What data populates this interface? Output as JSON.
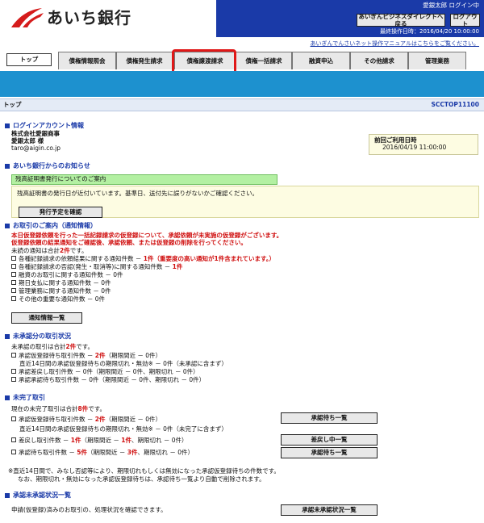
{
  "header": {
    "logo_text": "あいち銀行",
    "user_status": "愛銀太郎 ログイン中",
    "btn_direct": "あいぎんビジネスダイレクトへ戻る",
    "btn_logout": "ログアウト",
    "last_operation": "最終操作日時：2016/04/20 10:00:00",
    "manual_link": "あいぎんでんさいネット操作マニュアルはこちらをご覧ください。"
  },
  "tabs": [
    "トップ",
    "債権情報照会",
    "債権発生請求",
    "債権譲渡請求",
    "債権一括請求",
    "融資申込",
    "その他請求",
    "管理業務"
  ],
  "title_bar": {
    "title": "トップ",
    "code": "SCCTOP11100"
  },
  "login_account": {
    "heading": "ログインアカウント情報",
    "company": "株式会社愛銀商事",
    "name": "愛銀太郎 様",
    "email": "taro@aigin.co.jp",
    "last_login_label": "前回ご利用日時",
    "last_login_value": "2016/04/19 11:00:00"
  },
  "notice": {
    "heading": "あいち銀行からのお知らせ",
    "bar_text": "残高証明書発行についてのご案内",
    "body": "残高証明書の発行日が近付いています。基準日、送付先に誤りがないかご確認ください。",
    "button": "発行予定を確認"
  },
  "transactions_notice": {
    "heading": "お取引のご案内（通知情報）",
    "alert1": "本日仮登録依頼を行った一括記録請求の仮登録について、承認依頼が未実施の仮登録がございます。",
    "alert2": "仮登録依頼の結果通知をご確認後、承認依頼、または仮登録の削除を行ってください。",
    "unread_prefix": "未読の通知は合計",
    "unread_count": "2件",
    "unread_suffix": "です。",
    "items": [
      {
        "label": "各種記録請求の依頼結果に関する通知件数 －",
        "count": "1件（重要度の高い通知が1件含まれています。）",
        "red": true
      },
      {
        "label": "各種記録請求の否認(発生・取消等)に関する通知件数 －",
        "count": "1件",
        "red": true
      },
      {
        "label": "融資のお取引に関する通知件数 －",
        "count": "0件",
        "red": false
      },
      {
        "label": "期日支払に関する通知件数 －",
        "count": "0件",
        "red": false
      },
      {
        "label": "管理業務に関する通知件数 －",
        "count": "0件",
        "red": false
      },
      {
        "label": "その他の重要な通知件数 －",
        "count": "0件",
        "red": false
      }
    ],
    "button": "通知情報一覧"
  },
  "unapproved": {
    "heading": "未承認分の取引状況",
    "total_prefix": "未承認の取引は合計",
    "total_count": "2件",
    "total_suffix": "です。",
    "line1_label": "承認仮登録待ち取引件数 －",
    "line1_count": "2件",
    "line1_rest": "（期限間近 － 0件）",
    "line1_sub": "直近14日間の承認仮登録待ちの期限切れ・無効※ － 0件（未承認に含まず）",
    "line2": "承認差戻し取引件数 － 0件（期限間近 － 0件、期限切れ － 0件）",
    "line3": "承認承認待ち取引件数 － 0件（期限間近 － 0件、期限切れ － 0件）"
  },
  "incomplete": {
    "heading": "未完了取引",
    "total_prefix": "現在の未完了取引は合計",
    "total_count": "8件",
    "total_suffix": "です。",
    "line1_label": "承認仮登録待ち取引件数 －",
    "line1_count": "2件",
    "line1_rest": "（期限間近 － 0件）",
    "line1_sub": "直近14日間の承認仮登録待ちの期限切れ・無効※ － 0件（未完了に含まず）",
    "line2_label": "差戻し取引件数 －",
    "line2_count": "1件",
    "line2_mid": "（期限間近 －",
    "line2_count2": "1件",
    "line2_rest": "、期限切れ － 0件）",
    "line3_label": "承認待ち取引件数 －",
    "line3_count": "5件",
    "line3_mid": "（期限間近 －",
    "line3_count2": "3件",
    "line3_rest": "、期限切れ － 0件）",
    "btn1": "承認待ち一覧",
    "btn2": "差戻し中一覧",
    "btn3": "承認待ち一覧",
    "note1": "※直近14日間で、みなし否認等により、期限切れもしくは無効になった承認仮登録待ちの件数です。",
    "note2": "なお、期限切れ・無効になった承認仮登録待ちは、承認待ち一覧より自動で削除されます。"
  },
  "approval_status": {
    "heading": "承認未承認状況一覧",
    "text": "申請(仮登録)済みのお取引の、処理状況を確認できます。",
    "button": "承認未承認状況一覧"
  }
}
